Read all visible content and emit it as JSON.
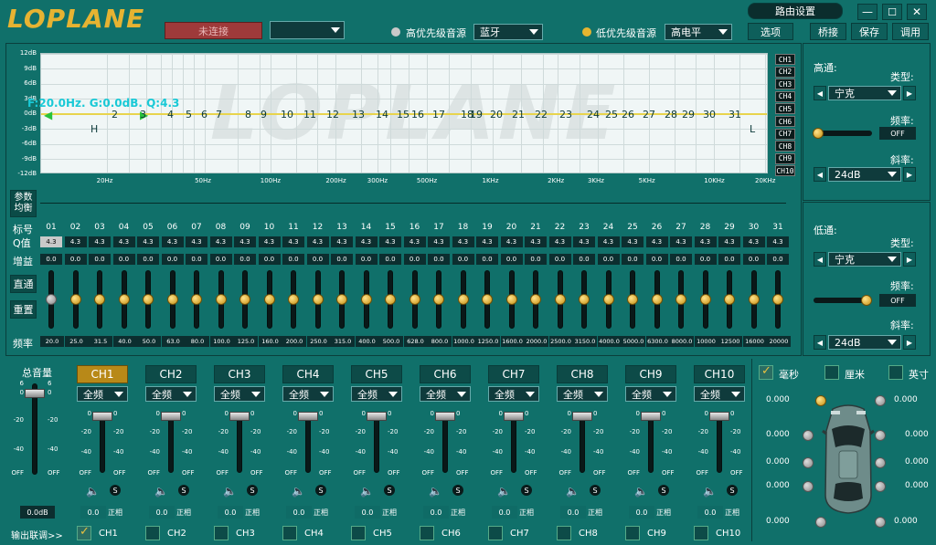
{
  "app": {
    "logo": "LOPLANE",
    "connect_label": "未连接",
    "device_value": "",
    "high_source_label": "高优先级音源",
    "high_source_value": "蓝牙",
    "low_source_label": "低优先级音源",
    "low_source_value": "高电平",
    "route_label": "路由设置",
    "menu": [
      "选项",
      "桥接",
      "保存",
      "调用"
    ]
  },
  "eq": {
    "ylabels": [
      "12dB",
      "9dB",
      "6dB",
      "3dB",
      "0dB",
      "-3dB",
      "-6dB",
      "-9dB",
      "-12dB"
    ],
    "xlabels": [
      {
        "t": "20Hz",
        "p": 0.09
      },
      {
        "t": "50Hz",
        "p": 0.225
      },
      {
        "t": "100Hz",
        "p": 0.315
      },
      {
        "t": "200Hz",
        "p": 0.405
      },
      {
        "t": "300Hz",
        "p": 0.462
      },
      {
        "t": "500Hz",
        "p": 0.53
      },
      {
        "t": "1KHz",
        "p": 0.62
      },
      {
        "t": "2KHz",
        "p": 0.71
      },
      {
        "t": "3KHz",
        "p": 0.765
      },
      {
        "t": "5KHz",
        "p": 0.835
      },
      {
        "t": "10KHz",
        "p": 0.925
      },
      {
        "t": "20KHz",
        "p": 0.995
      }
    ],
    "info": "F:20.0Hz. G:0.0dB. Q:4.3",
    "points": [
      "2",
      "3",
      "4",
      "5",
      "6",
      "7",
      "8",
      "9",
      "10",
      "11",
      "12",
      "13",
      "14",
      "15",
      "16",
      "17",
      "18",
      "19",
      "20",
      "21",
      "22",
      "23",
      "24",
      "25",
      "26",
      "27",
      "28",
      "29",
      "30",
      "31"
    ],
    "marker_h": "H",
    "marker_l": "L",
    "channels": [
      "CH1",
      "CH2",
      "CH3",
      "CH4",
      "CH5",
      "CH6",
      "CH7",
      "CH8",
      "CH9",
      "CH10"
    ]
  },
  "bands": {
    "param_label": "参数均衡",
    "row_label_num": "标号",
    "row_label_q": "Q值",
    "row_label_gain": "增益",
    "row_label_freq": "频率",
    "bypass_label": "直通",
    "reset_label": "重置",
    "numbers": [
      "01",
      "02",
      "03",
      "04",
      "05",
      "06",
      "07",
      "08",
      "09",
      "10",
      "11",
      "12",
      "13",
      "14",
      "15",
      "16",
      "17",
      "18",
      "19",
      "20",
      "21",
      "22",
      "23",
      "24",
      "25",
      "26",
      "27",
      "28",
      "29",
      "30",
      "31"
    ],
    "q": "4.3",
    "gain": "0.0",
    "freqs": [
      "20.0",
      "25.0",
      "31.5",
      "40.0",
      "50.0",
      "63.0",
      "80.0",
      "100.0",
      "125.0",
      "160.0",
      "200.0",
      "250.0",
      "315.0",
      "400.0",
      "500.0",
      "628.0",
      "800.0",
      "1000.0",
      "1250.0",
      "1600.0",
      "2000.0",
      "2500.0",
      "3150.0",
      "4000.0",
      "5000.0",
      "6300.0",
      "8000.0",
      "10000",
      "12500",
      "16000",
      "20000"
    ]
  },
  "hp": {
    "title": "高通:",
    "type_label": "类型:",
    "type_value": "宁克",
    "freq_label": "频率:",
    "freq_value": "OFF",
    "slope_label": "斜率:",
    "slope_value": "24dB"
  },
  "lp": {
    "title": "低通:",
    "type_label": "类型:",
    "type_value": "宁克",
    "freq_label": "频率:",
    "freq_value": "OFF",
    "slope_label": "斜率:",
    "slope_value": "24dB"
  },
  "master": {
    "label": "总音量",
    "scale": [
      "6",
      "0",
      "-20",
      "-40",
      "OFF"
    ],
    "value": "0.0dB"
  },
  "mixer": {
    "channels": [
      "CH1",
      "CH2",
      "CH3",
      "CH4",
      "CH5",
      "CH6",
      "CH7",
      "CH8",
      "CH9",
      "CH10"
    ],
    "mode": "全频",
    "scale": [
      "0",
      "-20",
      "-40",
      "OFF"
    ],
    "value": "0.0",
    "phase": "正相"
  },
  "link": {
    "label": "输出联调>>",
    "channels": [
      "CH1",
      "CH2",
      "CH3",
      "CH4",
      "CH5",
      "CH6",
      "CH7",
      "CH8",
      "CH9",
      "CH10"
    ]
  },
  "units": {
    "ms": "毫秒",
    "cm": "厘米",
    "inch": "英寸"
  },
  "delay": {
    "values": [
      "0.000",
      "0.000",
      "0.000",
      "0.000",
      "0.000",
      "0.000",
      "0.000",
      "0.000",
      "0.000",
      "0.000"
    ]
  },
  "colors": {
    "bg": "#10706a",
    "accent": "#d6a520",
    "graph_line": "#e8d44d"
  }
}
